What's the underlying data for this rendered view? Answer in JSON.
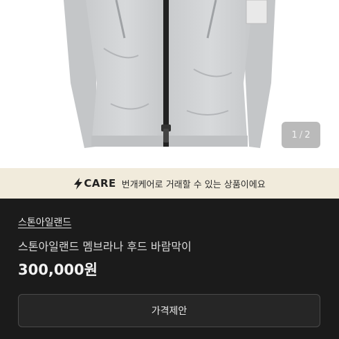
{
  "photo": {
    "alt_subject": "jacket-photo",
    "counter_current": "1",
    "counter_separator": "/",
    "counter_total": "2"
  },
  "care": {
    "logo_text": "CARE",
    "message": "번개케어로 거래할 수 있는 상품이에요",
    "accent": "#f1ebdc"
  },
  "product": {
    "store_name": "스톤아일랜드",
    "title": "스톤아일랜드 멤브라나 후드 바람막이",
    "price": "300,000원"
  },
  "actions": {
    "offer_label": "가격제안"
  }
}
